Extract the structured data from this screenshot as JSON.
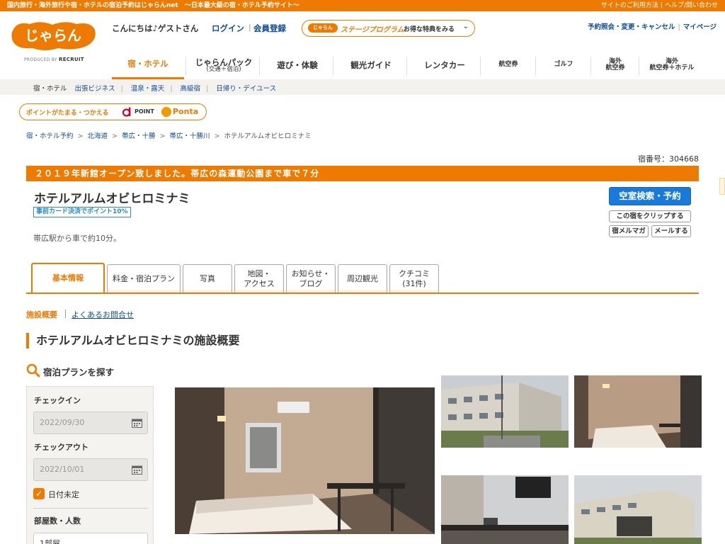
{
  "topbar": {
    "tagline": "国内旅行・海外旅行や宿・ホテルの宿泊予約はじゃらんnet　〜日本最大級の宿・ホテル予約サイト〜",
    "links": [
      "サイトのご利用方法",
      "ヘルプ/問い合わせ"
    ]
  },
  "header": {
    "logo_text": "じゃらん",
    "produced_by": "PRODUCED BY",
    "recruit": "RECRUIT",
    "greeting": "こんにちは♪ゲストさん",
    "login": "ログイン",
    "register": "会員登録",
    "stage_pill": "じゃらん",
    "stage_title": "ステージプログラム",
    "stage_benefit": "お得な特典をみる",
    "right_links": [
      "予約照会・変更・キャンセル",
      "マイページ"
    ]
  },
  "nav": {
    "items": [
      {
        "label": "宿・ホテル",
        "sub": ""
      },
      {
        "label": "じゃらんパック",
        "sub": "(交通＋宿泊)"
      },
      {
        "label": "遊び・体験",
        "sub": ""
      },
      {
        "label": "観光ガイド",
        "sub": ""
      },
      {
        "label": "レンタカー",
        "sub": ""
      },
      {
        "label": "航空券",
        "sub": ""
      },
      {
        "label": "ゴルフ",
        "sub": ""
      },
      {
        "label": "海外",
        "sub": "航空券"
      },
      {
        "label": "海外",
        "sub": "航空券＋ホテル"
      }
    ],
    "subnav": [
      "宿・ホテル",
      "出張ビジネス",
      "温泉・露天",
      "高級宿",
      "日帰り・デイユース"
    ]
  },
  "points_banner": {
    "text": "ポイントがたまる・つかえる",
    "dpoint": "POINT",
    "ponta": "Ponta"
  },
  "breadcrumb": [
    "宿・ホテル予約",
    "北海道",
    "帯広・十勝",
    "帯広・十勝川",
    "ホテルアルムオビヒロミナミ"
  ],
  "hotel": {
    "yado_number": "宿番号：304668",
    "catch": "２０１９年新館オープン致しました。帯広の森運動公園まで車で７分",
    "name": "ホテルアルムオビヒロミナミ",
    "badge": "事前カード決済でポイント10%",
    "access": "帯広駅から車で約10分。",
    "btn_search": "空室検索・予約",
    "btn_clip": "この宿をクリップする",
    "btn_magazine": "宿メルマガ",
    "btn_mail": "メールする"
  },
  "tabs": [
    {
      "line1": "基本情報",
      "line2": ""
    },
    {
      "line1": "料金・宿泊プラン",
      "line2": ""
    },
    {
      "line1": "写真",
      "line2": ""
    },
    {
      "line1": "地図・",
      "line2": "アクセス"
    },
    {
      "line1": "お知らせ・",
      "line2": "ブログ"
    },
    {
      "line1": "周辺観光",
      "line2": ""
    },
    {
      "line1": "クチコミ",
      "line2": "(31件)"
    }
  ],
  "anchors": {
    "current": "施設概要",
    "faq": "よくあるお問合せ"
  },
  "section_title": "ホテルアルムオビヒロミナミの施設概要",
  "search": {
    "heading": "宿泊プランを探す",
    "checkin_label": "チェックイン",
    "checkin_value": "2022/09/30",
    "checkout_label": "チェックアウト",
    "checkout_value": "2022/10/01",
    "undecided": "日付未定",
    "rooms_label": "部屋数・人数",
    "rooms_value": "1部屋"
  },
  "colors": {
    "brand": "#ee7a00",
    "link": "#0f4c98",
    "button": "#1a7ad9"
  }
}
